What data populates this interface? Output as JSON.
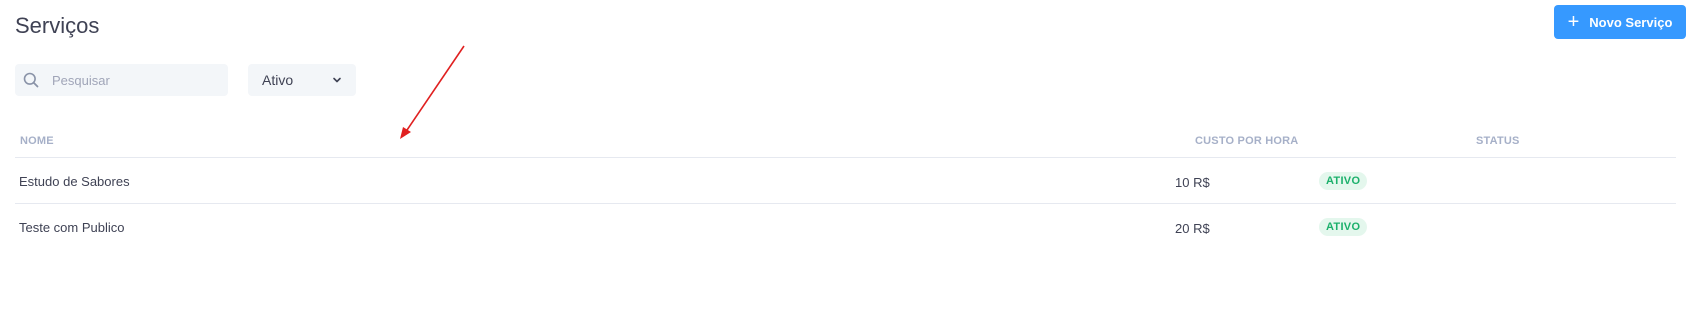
{
  "header": {
    "title": "Serviços",
    "new_button_label": "Novo Serviço",
    "new_button_icon": "plus-icon"
  },
  "filters": {
    "search_placeholder": "Pesquisar",
    "search_value": "",
    "status_selected": "Ativo",
    "search_icon": "search-icon",
    "status_icon": "chevron-down-icon"
  },
  "table": {
    "columns": [
      "NOME",
      "CUSTO POR HORA",
      "STATUS"
    ],
    "rows": [
      {
        "name": "Estudo de Sabores",
        "cost": "10 R$",
        "status": "ATIVO"
      },
      {
        "name": "Teste com Publico",
        "cost": "20 R$",
        "status": "ATIVO"
      }
    ]
  },
  "annotation": {
    "color": "#e02020",
    "type": "arrow"
  },
  "colors": {
    "accent": "#3699ff",
    "badge_bg": "#e4f7ed",
    "badge_text": "#1bb06b",
    "header_text": "#a6b0c8"
  }
}
